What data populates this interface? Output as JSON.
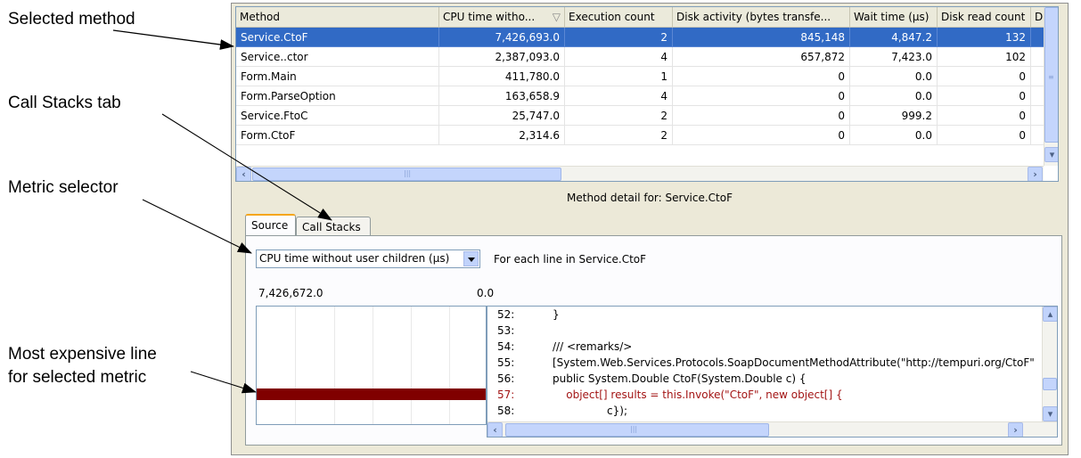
{
  "callouts": {
    "selected_method": "Selected method",
    "call_stacks_tab": "Call Stacks tab",
    "metric_selector": "Metric selector",
    "most_expensive_1": "Most expensive line",
    "most_expensive_2": "for selected metric"
  },
  "grid": {
    "headers": [
      "Method",
      "CPU time witho...",
      "Execution count",
      "Disk activity (bytes transfe...",
      "Wait time (µs)",
      "Disk read count",
      "D"
    ],
    "sort_indicator": "▽",
    "rows": [
      [
        "Service.CtoF",
        "7,426,693.0",
        "2",
        "845,148",
        "4,847.2",
        "132"
      ],
      [
        "Service..ctor",
        "2,387,093.0",
        "4",
        "657,872",
        "7,423.0",
        "102"
      ],
      [
        "Form.Main",
        "411,780.0",
        "1",
        "0",
        "0.0",
        "0"
      ],
      [
        "Form.ParseOption",
        "163,658.9",
        "4",
        "0",
        "0.0",
        "0"
      ],
      [
        "Service.FtoC",
        "25,747.0",
        "2",
        "0",
        "999.2",
        "0"
      ],
      [
        "Form.CtoF",
        "2,314.6",
        "2",
        "0",
        "0.0",
        "0"
      ]
    ],
    "selected_row": 0
  },
  "detail": {
    "title": "Method detail for: Service.CtoF",
    "tabs": [
      "Source",
      "Call Stacks"
    ],
    "active_tab": "Source",
    "metric_select_value": "CPU time without user children (µs)",
    "for_each_line": "For each line in Service.CtoF",
    "scale_max": "7,426,672.0",
    "scale_min": "0.0"
  },
  "code": {
    "lines": [
      {
        "no": "52:",
        "text": "}"
      },
      {
        "no": "53:",
        "text": ""
      },
      {
        "no": "54:",
        "text": "/// <remarks/>"
      },
      {
        "no": "55:",
        "text": "[System.Web.Services.Protocols.SoapDocumentMethodAttribute(\"http://tempuri.org/CtoF\""
      },
      {
        "no": "56:",
        "text": "public System.Double CtoF(System.Double c) {"
      },
      {
        "no": "57:",
        "text": "    object[] results = this.Invoke(\"CtoF\", new object[] {"
      },
      {
        "no": "58:",
        "text": "                c});"
      }
    ],
    "hot_line_index": 5
  },
  "line_costs": [
    0,
    0,
    0,
    0,
    0,
    1.0,
    0
  ],
  "colors": {
    "selection": "#316ac5",
    "hot_bar": "#800000",
    "hot_text": "#a31515",
    "active_tab_accent": "#f5a61d"
  },
  "icons": [
    "scroll-left-icon",
    "scroll-right-icon",
    "scroll-up-icon",
    "scroll-down-icon",
    "dropdown-arrow-icon"
  ]
}
